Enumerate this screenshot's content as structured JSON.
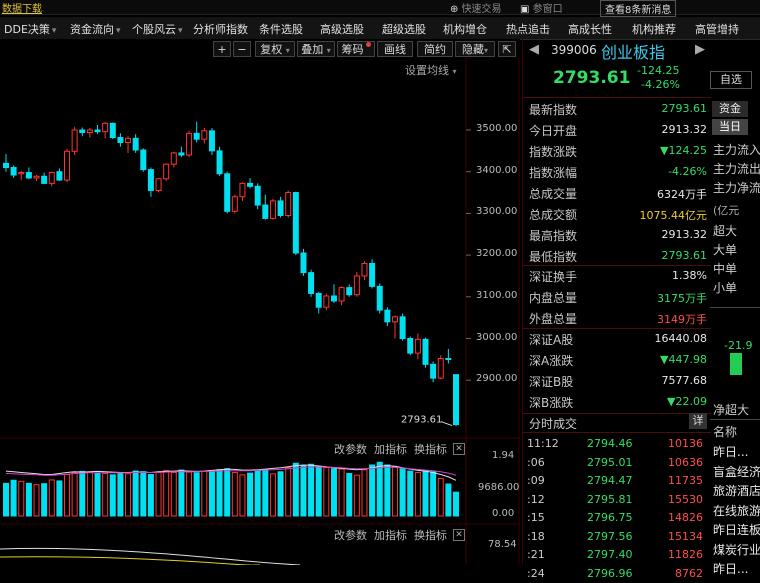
{
  "topbar": {
    "left_text": "数据下载",
    "quick_trade": "快速交易",
    "chat": "参窗口",
    "news": "查看8条新消息"
  },
  "menu": [
    {
      "label": "DDE决策",
      "arrow": true
    },
    {
      "label": "资金流向",
      "arrow": true
    },
    {
      "label": "个股风云",
      "arrow": true
    },
    {
      "label": "分析师指数",
      "arrow": false
    },
    {
      "label": "条件选股",
      "arrow": false
    },
    {
      "label": "高级选股",
      "arrow": false
    },
    {
      "label": "超级选股",
      "arrow": false
    },
    {
      "label": "机构增仓",
      "arrow": false
    },
    {
      "label": "热点追击",
      "arrow": false
    },
    {
      "label": "高成长性",
      "arrow": false
    },
    {
      "label": "机构推荐",
      "arrow": false
    },
    {
      "label": "高管增持",
      "arrow": false
    }
  ],
  "chart_toolbar": {
    "zoom_in": "+",
    "zoom_out": "−",
    "fq": "复权",
    "overlay": "叠加",
    "chips": "筹码",
    "draw": "画线",
    "simple": "简约",
    "hide": "隐藏",
    "expand": "⇱"
  },
  "settings_label": "设置均线",
  "colors": {
    "up": "#ff3333",
    "down": "#00e0f0",
    "bg": "#000000",
    "grid": "#3a0000"
  },
  "chart_data": [
    {
      "type": "candlestick",
      "ylim": [
        2760,
        3580
      ],
      "yticks": [
        3500.0,
        3400.0,
        3300.0,
        3200.0,
        3100.0,
        3000.0,
        2900.0
      ],
      "last_label": "2793.61",
      "candles": [
        [
          3420,
          3442,
          3400,
          3410
        ],
        [
          3410,
          3415,
          3385,
          3392
        ],
        [
          3395,
          3402,
          3380,
          3398
        ],
        [
          3398,
          3410,
          3382,
          3385
        ],
        [
          3385,
          3392,
          3378,
          3389
        ],
        [
          3389,
          3398,
          3370,
          3372
        ],
        [
          3372,
          3400,
          3365,
          3398
        ],
        [
          3400,
          3408,
          3378,
          3380
        ],
        [
          3380,
          3455,
          3375,
          3449
        ],
        [
          3449,
          3508,
          3440,
          3500
        ],
        [
          3500,
          3506,
          3485,
          3494
        ],
        [
          3494,
          3505,
          3482,
          3500
        ],
        [
          3500,
          3512,
          3490,
          3496
        ],
        [
          3496,
          3520,
          3480,
          3516
        ],
        [
          3516,
          3518,
          3478,
          3482
        ],
        [
          3482,
          3492,
          3460,
          3470
        ],
        [
          3470,
          3485,
          3445,
          3480
        ],
        [
          3480,
          3490,
          3445,
          3452
        ],
        [
          3452,
          3456,
          3400,
          3405
        ],
        [
          3405,
          3410,
          3340,
          3355
        ],
        [
          3355,
          3385,
          3350,
          3383
        ],
        [
          3383,
          3420,
          3378,
          3418
        ],
        [
          3418,
          3448,
          3410,
          3445
        ],
        [
          3445,
          3460,
          3435,
          3440
        ],
        [
          3440,
          3498,
          3435,
          3492
        ],
        [
          3492,
          3520,
          3470,
          3478
        ],
        [
          3478,
          3505,
          3468,
          3498
        ],
        [
          3498,
          3505,
          3440,
          3450
        ],
        [
          3450,
          3460,
          3390,
          3395
        ],
        [
          3395,
          3400,
          3300,
          3305
        ],
        [
          3305,
          3345,
          3300,
          3340
        ],
        [
          3340,
          3375,
          3330,
          3372
        ],
        [
          3372,
          3385,
          3360,
          3365
        ],
        [
          3365,
          3372,
          3310,
          3320
        ],
        [
          3320,
          3345,
          3285,
          3288
        ],
        [
          3288,
          3335,
          3285,
          3330
        ],
        [
          3330,
          3340,
          3290,
          3295
        ],
        [
          3295,
          3355,
          3290,
          3350
        ],
        [
          3350,
          3352,
          3200,
          3205
        ],
        [
          3205,
          3215,
          3150,
          3158
        ],
        [
          3158,
          3165,
          3100,
          3108
        ],
        [
          3108,
          3112,
          3060,
          3075
        ],
        [
          3075,
          3108,
          3068,
          3102
        ],
        [
          3102,
          3130,
          3085,
          3090
        ],
        [
          3090,
          3125,
          3080,
          3122
        ],
        [
          3122,
          3130,
          3100,
          3105
        ],
        [
          3105,
          3160,
          3100,
          3150
        ],
        [
          3150,
          3185,
          3140,
          3180
        ],
        [
          3180,
          3190,
          3120,
          3125
        ],
        [
          3125,
          3132,
          3060,
          3068
        ],
        [
          3068,
          3075,
          3030,
          3040
        ],
        [
          3040,
          3055,
          3000,
          3052
        ],
        [
          3052,
          3060,
          2995,
          3000
        ],
        [
          3000,
          3005,
          2960,
          2965
        ],
        [
          2965,
          3012,
          2950,
          2998
        ],
        [
          2998,
          3002,
          2930,
          2938
        ],
        [
          2938,
          2945,
          2895,
          2905
        ],
        [
          2905,
          2960,
          2902,
          2952
        ],
        [
          2952,
          2975,
          2940,
          2950
        ],
        [
          2913.32,
          2913.32,
          2790,
          2793.61
        ]
      ]
    },
    {
      "type": "bar",
      "title": "volume",
      "yticks": [
        "1.94",
        "9686.00",
        "0.00"
      ],
      "values": [
        0.96,
        1.05,
        1.02,
        0.96,
        0.92,
        0.95,
        1.06,
        1.03,
        1.22,
        1.28,
        1.31,
        1.29,
        1.26,
        1.25,
        1.21,
        1.28,
        1.24,
        1.32,
        1.3,
        1.22,
        1.28,
        1.34,
        1.28,
        1.35,
        1.29,
        1.27,
        1.31,
        1.3,
        1.36,
        1.39,
        1.28,
        1.21,
        1.26,
        1.33,
        1.35,
        1.24,
        1.3,
        1.42,
        1.55,
        1.48,
        1.52,
        1.45,
        1.42,
        1.39,
        1.38,
        1.25,
        1.2,
        1.36,
        1.5,
        1.58,
        1.5,
        1.44,
        1.39,
        1.32,
        1.28,
        1.34,
        1.3,
        1.1,
        0.94,
        0.7
      ],
      "ma1": [
        1.32,
        1.3,
        1.28,
        1.26,
        1.24,
        1.22,
        1.22,
        1.25,
        1.28,
        1.3,
        1.29,
        1.3,
        1.31,
        1.3,
        1.29,
        1.28,
        1.28,
        1.29,
        1.29,
        1.28,
        1.3,
        1.31,
        1.32,
        1.33,
        1.32,
        1.31,
        1.32,
        1.34,
        1.36,
        1.38,
        1.37,
        1.35,
        1.35,
        1.36,
        1.38,
        1.4,
        1.42,
        1.45,
        1.48,
        1.5,
        1.49,
        1.47,
        1.45,
        1.42,
        1.4,
        1.38,
        1.36,
        1.38,
        1.42,
        1.46,
        1.48,
        1.46,
        1.42,
        1.38,
        1.34,
        1.32,
        1.28,
        1.22,
        1.15,
        1.05
      ],
      "ma2": [
        1.25,
        1.24,
        1.23,
        1.22,
        1.21,
        1.2,
        1.2,
        1.21,
        1.23,
        1.25,
        1.26,
        1.27,
        1.27,
        1.27,
        1.27,
        1.27,
        1.27,
        1.28,
        1.28,
        1.28,
        1.28,
        1.29,
        1.3,
        1.3,
        1.3,
        1.3,
        1.31,
        1.31,
        1.32,
        1.33,
        1.33,
        1.33,
        1.33,
        1.34,
        1.35,
        1.36,
        1.37,
        1.39,
        1.41,
        1.43,
        1.44,
        1.44,
        1.44,
        1.43,
        1.42,
        1.4,
        1.39,
        1.39,
        1.4,
        1.42,
        1.43,
        1.43,
        1.41,
        1.39,
        1.37,
        1.35,
        1.33,
        1.3,
        1.26,
        1.2
      ],
      "xlabel": "",
      "ylabel": ""
    }
  ],
  "panel_ctrl": {
    "params": "改参数",
    "add": "加指标",
    "switch": "换指标"
  },
  "bottom_tick": "78.54",
  "quote": {
    "code": "399006",
    "name": "创业板指",
    "price": "2793.61",
    "change": "-124.25",
    "pct": "-4.26%",
    "rows": [
      {
        "label": "最新指数",
        "value": "2793.61",
        "color": "green"
      },
      {
        "label": "今日开盘",
        "value": "2913.32",
        "color": "white"
      },
      {
        "label": "指数涨跌",
        "value": "▼124.25",
        "color": "green"
      },
      {
        "label": "指数涨幅",
        "value": "-4.26%",
        "color": "green"
      },
      {
        "label": "总成交量",
        "value": "6324万手",
        "color": "white"
      },
      {
        "label": "总成交额",
        "value": "1075.44亿元",
        "color": "yellow"
      },
      {
        "label": "最高指数",
        "value": "2913.32",
        "color": "white"
      },
      {
        "label": "最低指数",
        "value": "2793.61",
        "color": "green"
      },
      {
        "label": "深证换手",
        "value": "1.38%",
        "color": "white"
      },
      {
        "label": "内盘总量",
        "value": "3175万手",
        "color": "green"
      },
      {
        "label": "外盘总量",
        "value": "3149万手",
        "color": "red"
      },
      {
        "label": "深证A股",
        "value": "16440.08",
        "color": "white"
      },
      {
        "label": "深A涨跌",
        "value": "▼447.98",
        "color": "green"
      },
      {
        "label": "深证B股",
        "value": "7577.68",
        "color": "white"
      },
      {
        "label": "深B涨跌",
        "value": "▼22.09",
        "color": "green"
      }
    ],
    "ticks_title": "分时成交",
    "ticks_btn": "详",
    "ticks": [
      {
        "t": "11:12",
        "p": "2794.46",
        "v": "10136"
      },
      {
        "t": ":06",
        "p": "2795.01",
        "v": "10636"
      },
      {
        "t": ":09",
        "p": "2794.47",
        "v": "11735"
      },
      {
        "t": ":12",
        "p": "2795.81",
        "v": "15530"
      },
      {
        "t": ":15",
        "p": "2796.75",
        "v": "14826"
      },
      {
        "t": ":18",
        "p": "2797.56",
        "v": "15134"
      },
      {
        "t": ":21",
        "p": "2797.40",
        "v": "11826"
      },
      {
        "t": ":24",
        "p": "2796.96",
        "v": "8762"
      }
    ]
  },
  "far_right": {
    "select_btn": "自选",
    "tab1": "资金",
    "tab2": "当日",
    "flows": [
      "主力流入",
      "主力流出",
      "主力净流"
    ],
    "unit": "(亿元",
    "sizes": [
      "超大",
      "大单",
      "中单",
      "小单"
    ],
    "bar_value": "-21.9",
    "net_label": "净超大",
    "name_label": "名称",
    "list": [
      "昨日...",
      "盲盒经济",
      "旅游酒店",
      "在线旅游",
      "昨日连板",
      "煤炭行业",
      "昨日..."
    ]
  }
}
